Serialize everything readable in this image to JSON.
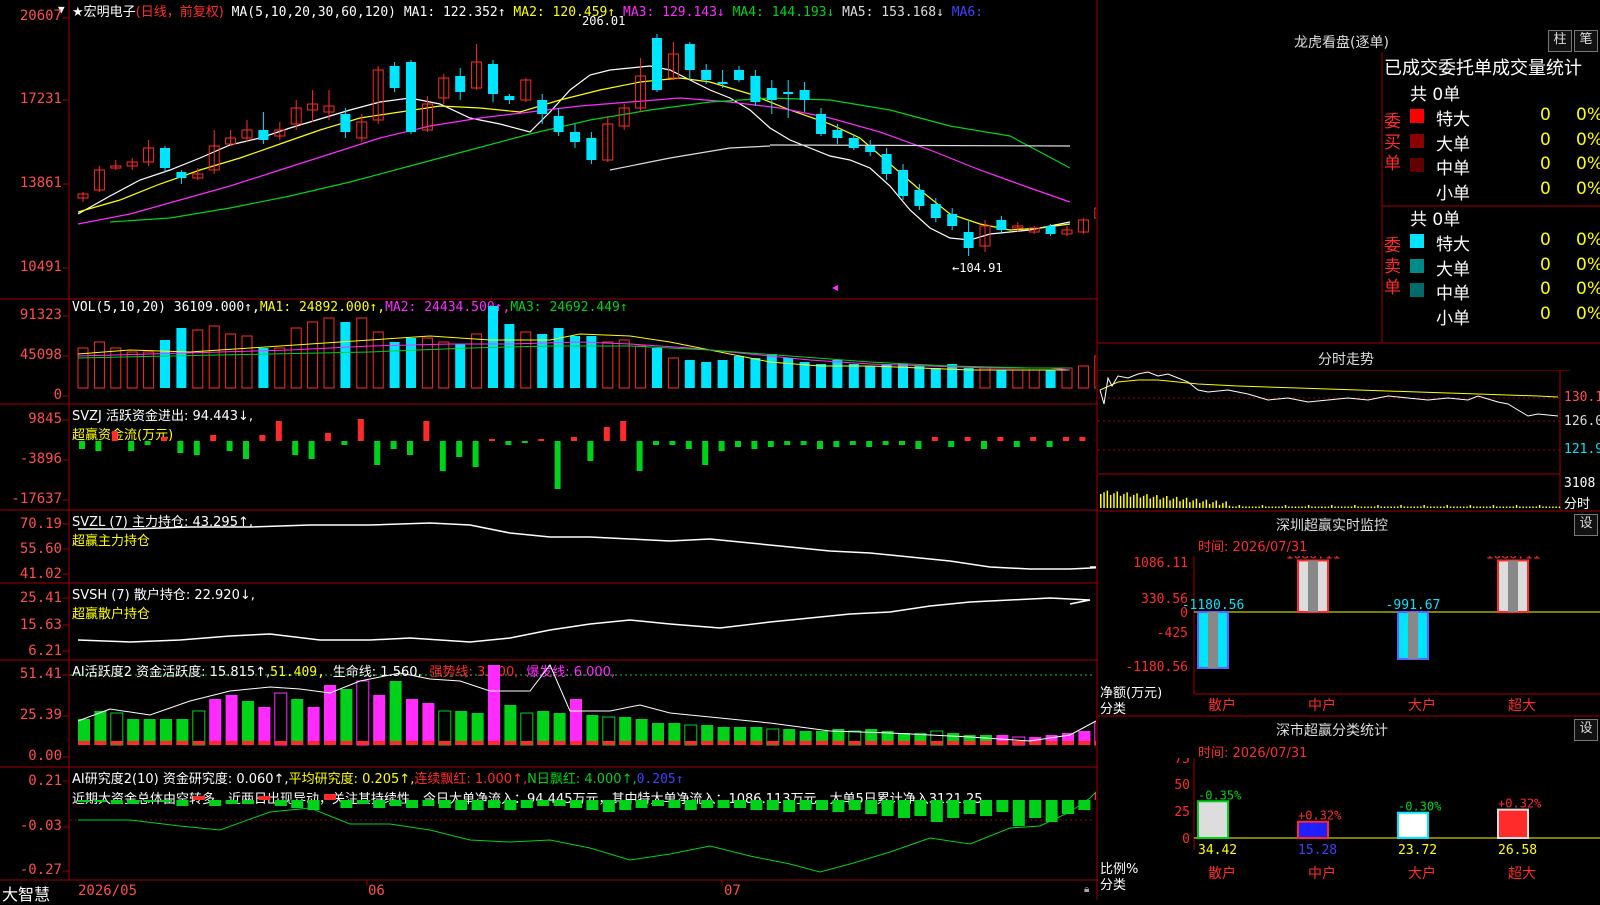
{
  "colors": {
    "up": "#ff2b2b",
    "down": "#00e5ff",
    "green": "#00d21a",
    "magenta": "#ff2bff",
    "yellow": "#ffff00",
    "white": "#ffffff",
    "grid": "#a00000"
  },
  "kline": {
    "stock_name": "★宏明电子",
    "mode": "(日线，前复权)",
    "ma_label": "MA(5,10,20,30,60,120)",
    "ma1": "MA1: 122.352↑",
    "ma2": "MA2: 120.459↑",
    "ma3": "MA3: 129.143↓",
    "ma4": "MA4: 144.193↓",
    "ma5": "MA5: 153.168↓",
    "ma6": "MA6:",
    "y_ticks": [
      "20607",
      "17231",
      "13861",
      "10491"
    ],
    "high_note": "206.01",
    "low_note": "←104.91"
  },
  "vol": {
    "label": "VOL(5,10,20) 36109.000↑,",
    "ma1": "MA1: 24892.000↑,",
    "ma2": "MA2: 24434.500↑,",
    "ma3": "MA3: 24692.449↑",
    "y_ticks": [
      "91323",
      "45098",
      "0"
    ]
  },
  "svzj": {
    "label": "SVZJ  活跃资金进出: 94.443↓,",
    "sub": "超赢资金流(万元)",
    "y_ticks": [
      "9845",
      "-3896",
      "-17637"
    ]
  },
  "svzl": {
    "label": "SVZL (7) 主力持仓: 43.295↑,",
    "sub": "超赢主力持仓",
    "y_ticks": [
      "70.19",
      "55.60",
      "41.02"
    ]
  },
  "svsh": {
    "label": "SVSH (7) 散户持仓: 22.920↓,",
    "sub": "超赢散户持仓",
    "y_ticks": [
      "25.41",
      "15.63",
      "6.21"
    ]
  },
  "ai_active": {
    "label1": "AI活跃度2 资金活跃度: 15.815↑,",
    "v2": "51.409,",
    "v3": "生命线: 1.560,",
    "v4": "强势线: 3.000,",
    "v5": "爆发线: 6.000,",
    "y_ticks": [
      "51.41",
      "25.39",
      "0.00"
    ]
  },
  "ai_research": {
    "label1": "AI研究度2(10) 资金研究度: 0.060↑,",
    "v2": "平均研究度: 0.205↑,",
    "v3": "连续飘红: 1.000↑,",
    "v4": "N日飘红: 4.000↑,",
    "v5": "0.205↑",
    "note": "近期大资金总体由空转多，近两日出现异动，关注其持续性，今日大单净流入：94.445万元，其中特大单净流入：1086.113万元，大单5日累计净入3121.25",
    "y_ticks": [
      "0.21",
      "-0.03",
      "-0.27"
    ]
  },
  "xaxis": {
    "brand": "大智慧",
    "labels": [
      "2026/05",
      "06",
      "07"
    ]
  },
  "right": {
    "lhb_title": "龙虎看盘(逐单)",
    "btn_bar": "柱",
    "btn_pen": "笔",
    "section_title": "已成交委托单成交量统计",
    "buy_label": "委买单",
    "sell_label": "委卖单",
    "buy_total": "共 0单",
    "sell_total": "共 0单",
    "buy_rows": [
      {
        "name": "特大",
        "qty": "0",
        "pct": "0%"
      },
      {
        "name": "大单",
        "qty": "0",
        "pct": "0%"
      },
      {
        "name": "中单",
        "qty": "0",
        "pct": "0%"
      },
      {
        "name": "小单",
        "qty": "0",
        "pct": "0%"
      }
    ],
    "sell_rows": [
      {
        "name": "特大",
        "qty": "0",
        "pct": "0%"
      },
      {
        "name": "大单",
        "qty": "0",
        "pct": "0%"
      },
      {
        "name": "中单",
        "qty": "0",
        "pct": "0%"
      },
      {
        "name": "小单",
        "qty": "0",
        "pct": "0%"
      }
    ],
    "intraday_title": "分时走势",
    "intraday_y": [
      "130.1",
      "126.0",
      "121.9",
      "3108"
    ],
    "intraday_y_unit": "分时",
    "monitor_title": "深圳超赢实时监控",
    "monitor_btn": "设",
    "monitor_time": "时间: 2026/07/31",
    "monitor_y": [
      "1086.11",
      "330.56",
      "0",
      "-425",
      "-1180.56"
    ],
    "monitor_axis_label1": "净额(万元)",
    "monitor_axis_label2": "分类",
    "monitor_cats": [
      "散户",
      "中户",
      "大户",
      "超大"
    ],
    "monitor_values": [
      "-1180.56",
      "1086.11",
      "-991.67",
      "1086.11"
    ],
    "stats_title": "深市超赢分类统计",
    "stats_btn": "设",
    "stats_time": "时间: 2026/07/31",
    "stats_y": [
      "75",
      "50",
      "25",
      "0"
    ],
    "stats_axis_label1": "比例%",
    "stats_axis_label2": "分类",
    "stats_cats": [
      "散户",
      "中户",
      "大户",
      "超大"
    ],
    "stats_values": [
      "34.42",
      "15.28",
      "23.72",
      "26.58"
    ],
    "stats_changes": [
      "-0.35%",
      "+0.32%",
      "-0.30%",
      "+0.32%"
    ]
  }
}
